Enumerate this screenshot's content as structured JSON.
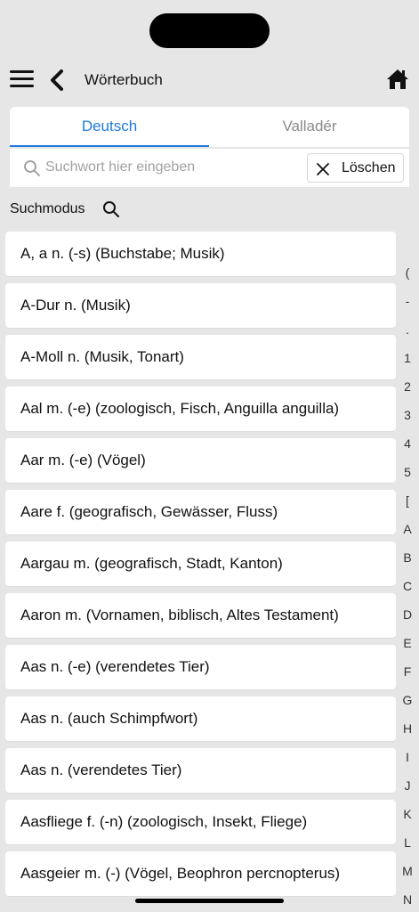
{
  "header": {
    "title": "Wörterbuch",
    "icons": {
      "menu": "hamburger-menu-icon",
      "back": "chevron-left-icon",
      "home": "house-icon"
    }
  },
  "tabs": [
    {
      "label": "Deutsch",
      "active": true
    },
    {
      "label": "Valladér",
      "active": false
    }
  ],
  "search": {
    "placeholder": "Suchwort hier eingeben",
    "value": "",
    "clear_label": "Löschen"
  },
  "mode": {
    "label": "Suchmodus"
  },
  "entries": [
    "A, a  n. (-s) (Buchstabe; Musik)",
    "A-Dur  n. (Musik)",
    "A-Moll  n. (Musik, Tonart)",
    "Aal  m. (-e) (zoologisch, Fisch, Anguilla anguilla)",
    "Aar  m. (-e) (Vögel)",
    "Aare  f. (geografisch, Gewässer, Fluss)",
    "Aargau  m. (geografisch, Stadt, Kanton)",
    "Aaron  m. (Vornamen, biblisch, Altes Testament)",
    "Aas  n. (-e) (verendetes Tier)",
    "Aas  n. (auch Schimpfwort)",
    "Aas  n. (verendetes Tier)",
    "Aasfliege  f. (-n) (zoologisch, Insekt, Fliege)",
    "Aasgeier  m. (-) (Vögel, Beophron percnopterus)"
  ],
  "index": [
    "(",
    "-",
    ".",
    "1",
    "2",
    "3",
    "4",
    "5",
    "[",
    "A",
    "B",
    "C",
    "D",
    "E",
    "F",
    "G",
    "H",
    "I",
    "J",
    "K",
    "L",
    "M",
    "N"
  ],
  "colors": {
    "accent": "#1e7ce0",
    "background": "#e6e6e6",
    "inactive_tab": "#8a8a8a"
  }
}
